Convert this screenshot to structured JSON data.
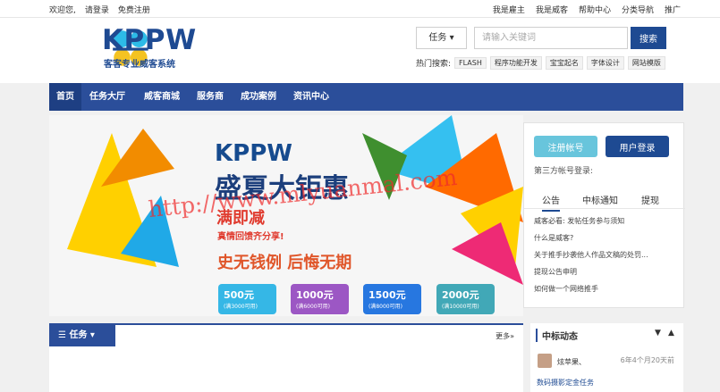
{
  "topbar": {
    "welcome": "欢迎您,",
    "login": "请登录",
    "register": "免费注册",
    "links": [
      "我是雇主",
      "我是威客",
      "帮助中心",
      "分类导航",
      "推广"
    ]
  },
  "header": {
    "brand": "KPPW",
    "subtitle": "客客专业威客系统"
  },
  "search": {
    "type": "任务",
    "placeholder": "请输入关键词",
    "button": "搜索",
    "hot_label": "热门搜索:",
    "hot": [
      "FLASH",
      "程序功能开发",
      "宝宝起名",
      "字体设计",
      "网站模版"
    ]
  },
  "nav": [
    "首页",
    "任务大厅",
    "威客商城",
    "服务商",
    "成功案例",
    "资讯中心"
  ],
  "banner": {
    "brand": "KPPW",
    "headline": "盛夏大钜惠",
    "sub": "满即减",
    "share": "真情回馈齐分享!",
    "slogan": "史无钱例 后悔无期",
    "coupons": [
      {
        "num": "500元",
        "sub": "(满3000可用)"
      },
      {
        "num": "1000元",
        "sub": "(满6000可用)"
      },
      {
        "num": "1500元",
        "sub": "(满8000可用)"
      },
      {
        "num": "2000元",
        "sub": "(满10000可用)"
      }
    ]
  },
  "watermark": "http://www.mlyuanmal.com",
  "side": {
    "register": "注册帐号",
    "login": "用户登录",
    "third": "第三方帐号登录:",
    "tabs": [
      "公告",
      "中标通知",
      "提现"
    ],
    "notices": [
      "威客必看: 发帖任务参与须知",
      "什么是威客?",
      "关于推手抄袭他人作品文稿的处罚...",
      "提现公告申明",
      "如何做一个网络推手"
    ]
  },
  "tasks": {
    "title": "任务",
    "more": "更多»"
  },
  "bid": {
    "title": "中标动态",
    "user": "炫苹果、",
    "time": "6年4个月20天前",
    "job": "数码摄影定金任务"
  },
  "colors": {
    "accent": "#2b4e9a",
    "button": "#1e4a92",
    "cyan": "#68c5dc"
  }
}
